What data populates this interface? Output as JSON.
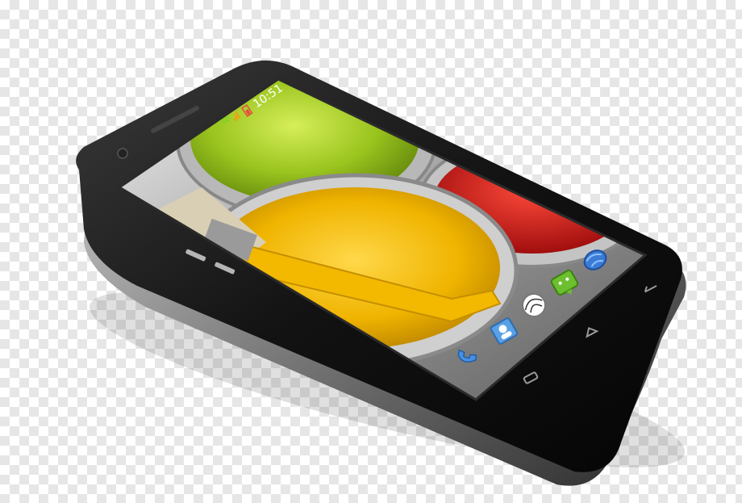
{
  "status_bar": {
    "time": "10:51"
  },
  "colors": {
    "body_frame": "#1a1a1a",
    "paint_green": "#9ac41e",
    "paint_red": "#d11d1d",
    "paint_yellow": "#f0b400"
  },
  "icons": {
    "status": [
      "wifi-icon",
      "signal-icon",
      "battery-icon"
    ],
    "home_screen": [
      "globe-app-icon",
      "messaging-app-icon",
      "browser-app-icon",
      "contacts-app-icon",
      "phone-app-icon"
    ],
    "nav_buttons": [
      "back-icon",
      "home-icon",
      "menu-icon"
    ]
  }
}
